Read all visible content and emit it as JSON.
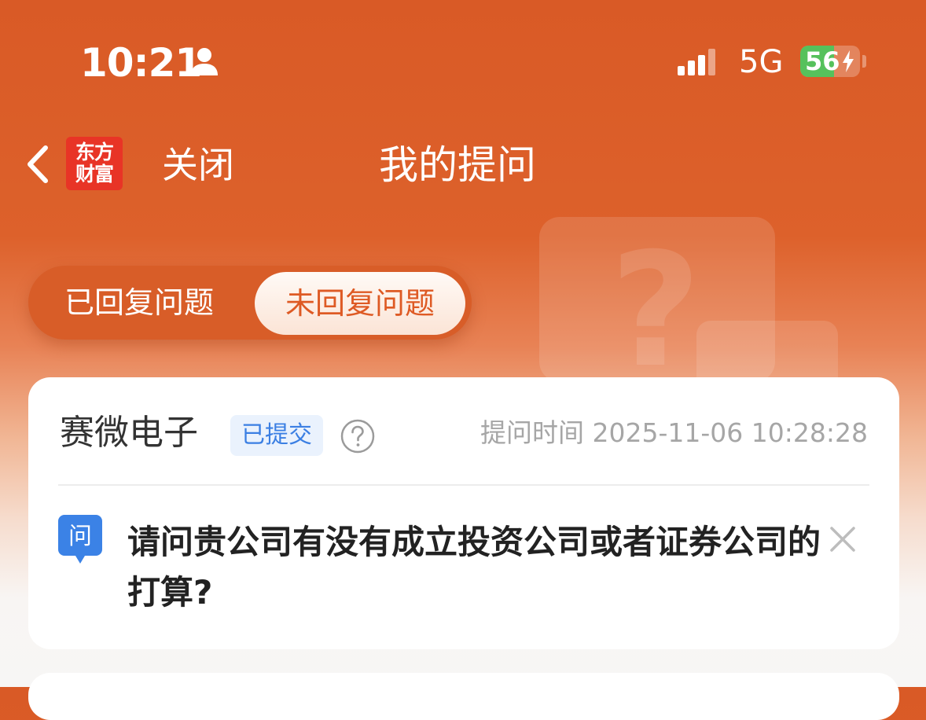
{
  "status_bar": {
    "time": "10:21",
    "network": "5G",
    "battery": "56",
    "battery_level": 0.56,
    "icons": [
      "person-icon",
      "signal-icon",
      "battery-icon",
      "charging-bolt-icon"
    ]
  },
  "nav": {
    "back_icon": "chevron-left-icon",
    "logo_line1": "东方",
    "logo_line2": "财富",
    "close_label": "关闭",
    "title": "我的提问"
  },
  "tabs": {
    "replied": "已回复问题",
    "unreplied": "未回复问题",
    "active": "unreplied"
  },
  "questions": [
    {
      "company": "赛微电子",
      "status": "已提交",
      "time_label": "提问时间 2025-11-06 10:28:28",
      "icon_label": "问",
      "text": "请问贵公司有没有成立投资公司或者证券公司的打算?"
    }
  ],
  "colors": {
    "header_orange": "#d95a26",
    "tab_active_text": "#de5a24",
    "badge_blue": "#3b7fe3",
    "badge_bg": "#eaf2fd",
    "battery_green": "#56c15c",
    "logo_red": "#e83426"
  }
}
